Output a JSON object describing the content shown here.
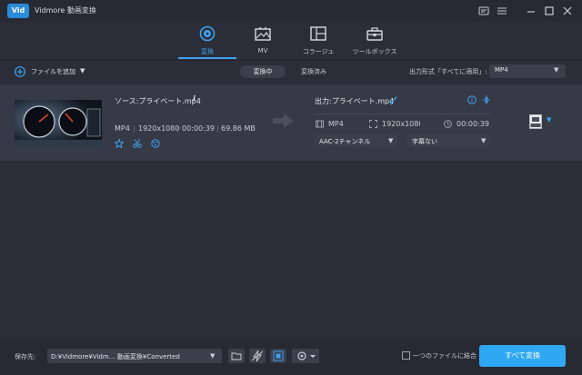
{
  "app": {
    "logo_text": "Vid",
    "title": "Vidmore 動画変換"
  },
  "nav": {
    "tabs": [
      {
        "label": "変換",
        "icon": "convert-icon",
        "active": true
      },
      {
        "label": "MV",
        "icon": "mv-icon",
        "active": false
      },
      {
        "label": "コラージュ",
        "icon": "collage-icon",
        "active": false
      },
      {
        "label": "ツールボックス",
        "icon": "toolbox-icon",
        "active": false
      }
    ]
  },
  "toolbar": {
    "add_file_label": "ファイルを追加",
    "converting_tab": "変換中",
    "converted_tab": "変換済み",
    "output_format_label": "出力形式「すべてに適用」:",
    "output_format_value": "MP4"
  },
  "file": {
    "source_name": "ソース:プライベート.mp4",
    "source_format": "MP4",
    "source_resolution": "1920x1080",
    "source_duration": "00:00:39",
    "source_size": "69.86 MB",
    "output_name": "出力:プライベート.mp4",
    "output_format": "MP4",
    "output_resolution": "1920x1080",
    "output_duration": "00:00:39",
    "audio_track": "AAC-2チャンネル",
    "subtitle": "字幕ない",
    "format_badge": "MP4"
  },
  "bottom": {
    "save_label": "保存先:",
    "save_path": "D:¥Vidmore¥Vidm… 動画変換¥Converted",
    "merge_label": "一つのファイルに結合",
    "convert_all_label": "すべて変換"
  },
  "colors": {
    "accent": "#2fa8f3",
    "background": "#2b2e38",
    "row": "#363a46"
  }
}
